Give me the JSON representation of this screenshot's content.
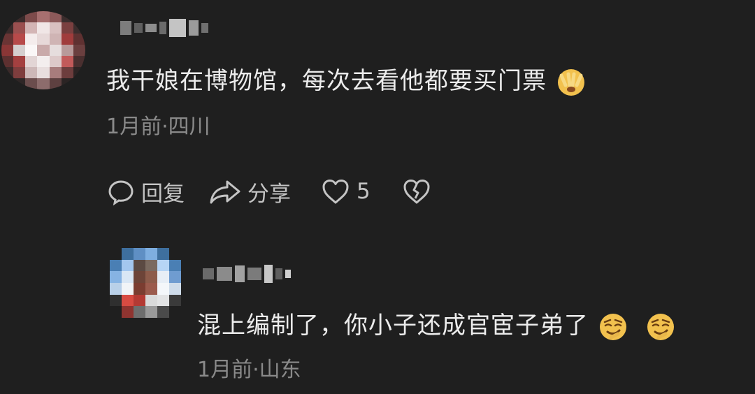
{
  "comments": [
    {
      "text": "我干娘在博物馆，每次去看他都要买门票",
      "emojis": [
        "covering-face-emoji"
      ],
      "meta": "1月前·四川",
      "actions": {
        "reply_label": "回复",
        "share_label": "分享",
        "like_count": "5"
      }
    },
    {
      "text": "混上编制了，你小子还成官宦子弟了",
      "emojis": [
        "smirking-face-emoji",
        "smirking-face-emoji"
      ],
      "meta": "1月前·山东"
    }
  ],
  "colors": {
    "background": "#1f1f1f",
    "primary_text": "#ececec",
    "secondary_text": "#8a8a8a",
    "action_text": "#c4c4c4"
  }
}
